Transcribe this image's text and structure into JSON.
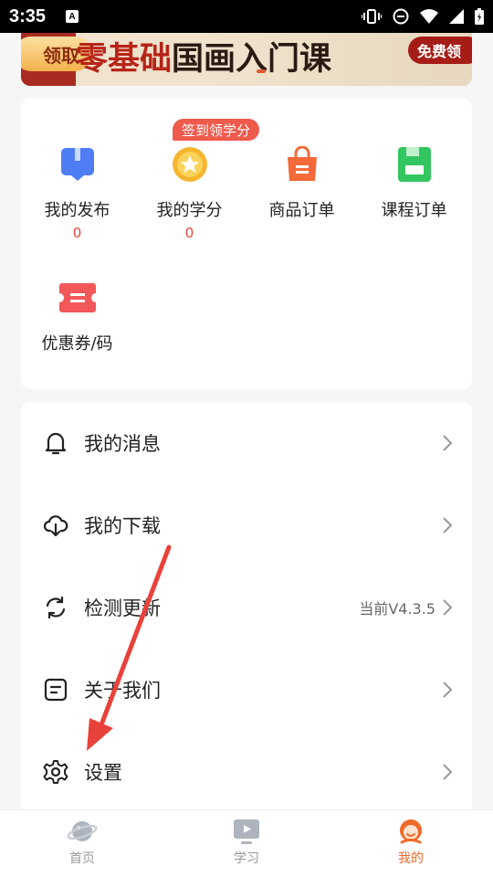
{
  "status_bar": {
    "time": "3:35",
    "notification_letter": "A"
  },
  "banner": {
    "left_pill": "领取",
    "title_red_1": "零基础",
    "title_dark": "国画入门课",
    "right_pill": "免费领"
  },
  "quick_grid": {
    "checkin_badge": "签到领学分",
    "items": [
      {
        "label": "我的发布",
        "count": "0",
        "icon": "bookmark-icon",
        "color": "#4f7df5"
      },
      {
        "label": "我的学分",
        "count": "0",
        "icon": "coin-star-icon",
        "color": "#f5b52e"
      },
      {
        "label": "商品订单",
        "icon": "shopping-bag-icon",
        "color": "#f46a3a"
      },
      {
        "label": "课程订单",
        "icon": "save-course-icon",
        "color": "#33c560"
      },
      {
        "label": "优惠券/码",
        "icon": "ticket-icon",
        "color": "#f2575a"
      }
    ]
  },
  "menu": {
    "items": [
      {
        "label": "我的消息",
        "icon": "bell-icon"
      },
      {
        "label": "我的下载",
        "icon": "cloud-download-icon"
      },
      {
        "label": "检测更新",
        "icon": "refresh-icon",
        "value": "当前V4.3.5"
      },
      {
        "label": "关于我们",
        "icon": "info-doc-icon"
      },
      {
        "label": "设置",
        "icon": "gear-icon"
      }
    ]
  },
  "bottom_nav": {
    "tabs": [
      {
        "label": "首页",
        "icon": "planet-icon"
      },
      {
        "label": "学习",
        "icon": "play-screen-icon"
      },
      {
        "label": "我的",
        "icon": "profile-mascot-icon",
        "active": true
      }
    ]
  },
  "colors": {
    "accent": "#f06a2a",
    "count_red": "#e3453a",
    "badge": "#ee5a4c",
    "annotation_arrow": "#e8423a"
  }
}
